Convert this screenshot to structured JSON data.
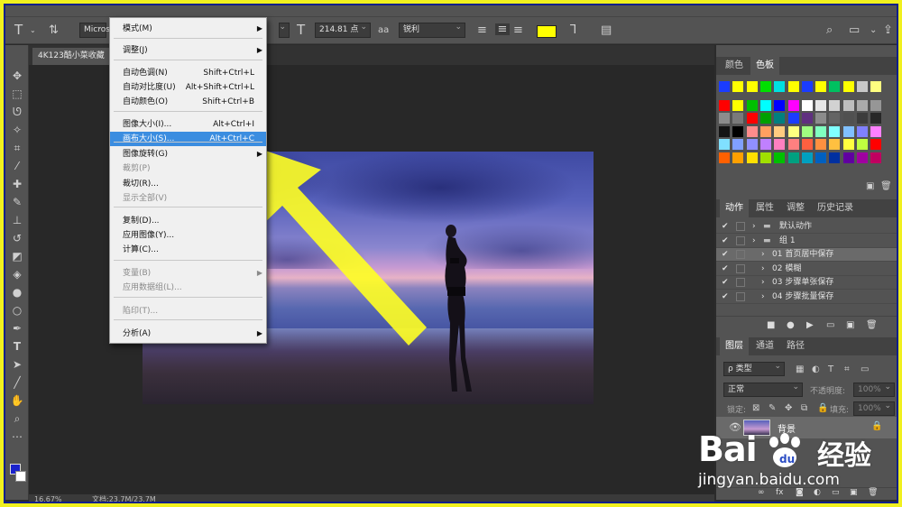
{
  "options_bar": {
    "font_family": "Microso",
    "font_size": "214.81 点",
    "antialias_label": "aa",
    "antialias_value": "锐利",
    "text_color": "#ffff00"
  },
  "document": {
    "tab_title": "4K123酷小菜收藏",
    "zoom": "16.67%",
    "doc_info": "文档:23.7M/23.7M"
  },
  "menu": {
    "items": [
      {
        "label": "模式(M)",
        "shortcut": "",
        "submenu": true,
        "disabled": false
      },
      {
        "label": "调整(J)",
        "shortcut": "",
        "submenu": true,
        "disabled": false
      },
      {
        "label": "自动色调(N)",
        "shortcut": "Shift+Ctrl+L",
        "submenu": false,
        "disabled": false
      },
      {
        "label": "自动对比度(U)",
        "shortcut": "Alt+Shift+Ctrl+L",
        "submenu": false,
        "disabled": false
      },
      {
        "label": "自动颜色(O)",
        "shortcut": "Shift+Ctrl+B",
        "submenu": false,
        "disabled": false
      },
      {
        "label": "图像大小(I)...",
        "shortcut": "Alt+Ctrl+I",
        "submenu": false,
        "disabled": false
      },
      {
        "label": "画布大小(S)...",
        "shortcut": "Alt+Ctrl+C",
        "submenu": false,
        "disabled": false,
        "highlighted": true
      },
      {
        "label": "图像旋转(G)",
        "shortcut": "",
        "submenu": true,
        "disabled": false
      },
      {
        "label": "裁剪(P)",
        "shortcut": "",
        "submenu": false,
        "disabled": true
      },
      {
        "label": "裁切(R)...",
        "shortcut": "",
        "submenu": false,
        "disabled": false
      },
      {
        "label": "显示全部(V)",
        "shortcut": "",
        "submenu": false,
        "disabled": true
      },
      {
        "label": "复制(D)...",
        "shortcut": "",
        "submenu": false,
        "disabled": false
      },
      {
        "label": "应用图像(Y)...",
        "shortcut": "",
        "submenu": false,
        "disabled": false
      },
      {
        "label": "计算(C)...",
        "shortcut": "",
        "submenu": false,
        "disabled": false
      },
      {
        "label": "变量(B)",
        "shortcut": "",
        "submenu": true,
        "disabled": true
      },
      {
        "label": "应用数据组(L)...",
        "shortcut": "",
        "submenu": false,
        "disabled": true
      },
      {
        "label": "陷印(T)...",
        "shortcut": "",
        "submenu": false,
        "disabled": true
      },
      {
        "label": "分析(A)",
        "shortcut": "",
        "submenu": true,
        "disabled": false
      }
    ]
  },
  "swatch_panel": {
    "tabs": [
      "颜色",
      "色板"
    ],
    "colors": [
      "#1a3cff",
      "#ffff00",
      "#ffff00",
      "#00e000",
      "#00e0e0",
      "#ffff00",
      "#1a3cff",
      "#ffff00",
      "#00c060",
      "#ffff00",
      "#c8c8c8",
      "#ffff80",
      "#ff0000",
      "#ffff00",
      "#00c000",
      "#00ffff",
      "#0000ff",
      "#ff00ff",
      "#ffffff",
      "#e6e6e6",
      "#d2d2d2",
      "#bebebe",
      "#aaaaaa",
      "#969696",
      "#8c8c8c",
      "#7a7a7a",
      "#ff0000",
      "#00a000",
      "#008080",
      "#1a3cff",
      "#603080",
      "#8c8c8c",
      "#646464",
      "#505050",
      "#3c3c3c",
      "#282828",
      "#141414",
      "#000000",
      "#ff8c8c",
      "#ff9f60",
      "#ffcc80",
      "#ffff80",
      "#a0ff80",
      "#80ffc0",
      "#80ffff",
      "#80c0ff",
      "#8080ff",
      "#ff80ff",
      "#80e0ff",
      "#80a0ff",
      "#9090ff",
      "#c080ff",
      "#ff80c0",
      "#ff8080",
      "#ff6040",
      "#ff9040",
      "#ffc040",
      "#ffff40",
      "#c0ff40",
      "#ff0000",
      "#ff6000",
      "#ffa000",
      "#ffe000",
      "#a0e000",
      "#00c000",
      "#00a080",
      "#00a0c0",
      "#0060c0",
      "#0030a0",
      "#6000a0",
      "#a000a0",
      "#c00060"
    ]
  },
  "actions_panel": {
    "tabs": [
      "动作",
      "属性",
      "调整",
      "历史记录"
    ],
    "rows": [
      {
        "label": "默认动作",
        "level": 0
      },
      {
        "label": "组 1",
        "level": 0
      },
      {
        "label": "01 首页居中保存",
        "level": 1
      },
      {
        "label": "02 模糊",
        "level": 1
      },
      {
        "label": "03 步骤单张保存",
        "level": 1
      },
      {
        "label": "04 步骤批量保存",
        "level": 1
      }
    ]
  },
  "layers_panel": {
    "tabs": [
      "图层",
      "通道",
      "路径"
    ],
    "kind_filter": "ρ 类型",
    "blend_mode": "正常",
    "opacity_label": "不透明度:",
    "opacity_value": "100%",
    "lock_label": "锁定:",
    "fill_label": "填充:",
    "fill_value": "100%",
    "layer_name": "背景"
  },
  "watermark": {
    "brand": "Bai 经验",
    "brand_mark": "Bai",
    "brand_cn": "经验",
    "url": "jingyan.baidu.com"
  }
}
